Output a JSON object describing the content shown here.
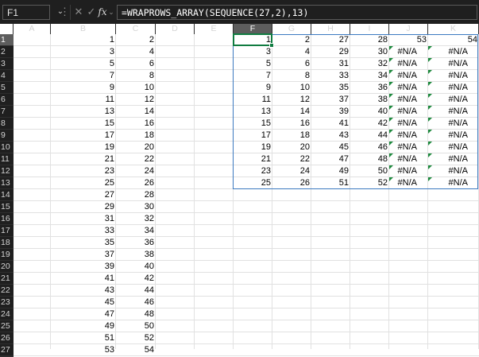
{
  "formula_bar": {
    "name_box": "F1",
    "formula": "=WRAPROWS_ARRAY(SEQUENCE(27,2),13)",
    "fx_label": "fx",
    "cancel_glyph": "✕",
    "enter_glyph": "✓",
    "more_glyph": "⋮"
  },
  "columns": [
    "A",
    "B",
    "C",
    "D",
    "E",
    "F",
    "G",
    "H",
    "I",
    "J",
    "K"
  ],
  "selected_column": "F",
  "rows": [
    "1",
    "2",
    "3",
    "4",
    "5",
    "6",
    "7",
    "8",
    "9",
    "10",
    "11",
    "12",
    "13",
    "14",
    "15",
    "16",
    "17",
    "18",
    "19",
    "20",
    "21",
    "22",
    "23",
    "24",
    "25",
    "26",
    "27"
  ],
  "selected_row": "1",
  "source_values": [
    [
      "1",
      "2"
    ],
    [
      "3",
      "4"
    ],
    [
      "5",
      "6"
    ],
    [
      "7",
      "8"
    ],
    [
      "9",
      "10"
    ],
    [
      "11",
      "12"
    ],
    [
      "13",
      "14"
    ],
    [
      "15",
      "16"
    ],
    [
      "17",
      "18"
    ],
    [
      "19",
      "20"
    ],
    [
      "21",
      "22"
    ],
    [
      "23",
      "24"
    ],
    [
      "25",
      "26"
    ],
    [
      "27",
      "28"
    ],
    [
      "29",
      "30"
    ],
    [
      "31",
      "32"
    ],
    [
      "33",
      "34"
    ],
    [
      "35",
      "36"
    ],
    [
      "37",
      "38"
    ],
    [
      "39",
      "40"
    ],
    [
      "41",
      "42"
    ],
    [
      "43",
      "44"
    ],
    [
      "45",
      "46"
    ],
    [
      "47",
      "48"
    ],
    [
      "49",
      "50"
    ],
    [
      "51",
      "52"
    ],
    [
      "53",
      "54"
    ]
  ],
  "spill_values": [
    [
      "1",
      "2",
      "27",
      "28",
      "53",
      "54"
    ],
    [
      "3",
      "4",
      "29",
      "30",
      "#N/A",
      "#N/A"
    ],
    [
      "5",
      "6",
      "31",
      "32",
      "#N/A",
      "#N/A"
    ],
    [
      "7",
      "8",
      "33",
      "34",
      "#N/A",
      "#N/A"
    ],
    [
      "9",
      "10",
      "35",
      "36",
      "#N/A",
      "#N/A"
    ],
    [
      "11",
      "12",
      "37",
      "38",
      "#N/A",
      "#N/A"
    ],
    [
      "13",
      "14",
      "39",
      "40",
      "#N/A",
      "#N/A"
    ],
    [
      "15",
      "16",
      "41",
      "42",
      "#N/A",
      "#N/A"
    ],
    [
      "17",
      "18",
      "43",
      "44",
      "#N/A",
      "#N/A"
    ],
    [
      "19",
      "20",
      "45",
      "46",
      "#N/A",
      "#N/A"
    ],
    [
      "21",
      "22",
      "47",
      "48",
      "#N/A",
      "#N/A"
    ],
    [
      "23",
      "24",
      "49",
      "50",
      "#N/A",
      "#N/A"
    ],
    [
      "25",
      "26",
      "51",
      "52",
      "#N/A",
      "#N/A"
    ]
  ],
  "colors": {
    "header_bg": "#1f1f1f",
    "header_selected_bg": "#5d5d5d",
    "gridline": "#e1e1e1",
    "spill_border": "#3b79c0",
    "active_border": "#107c41",
    "error_indicator": "#1e8a3e"
  }
}
